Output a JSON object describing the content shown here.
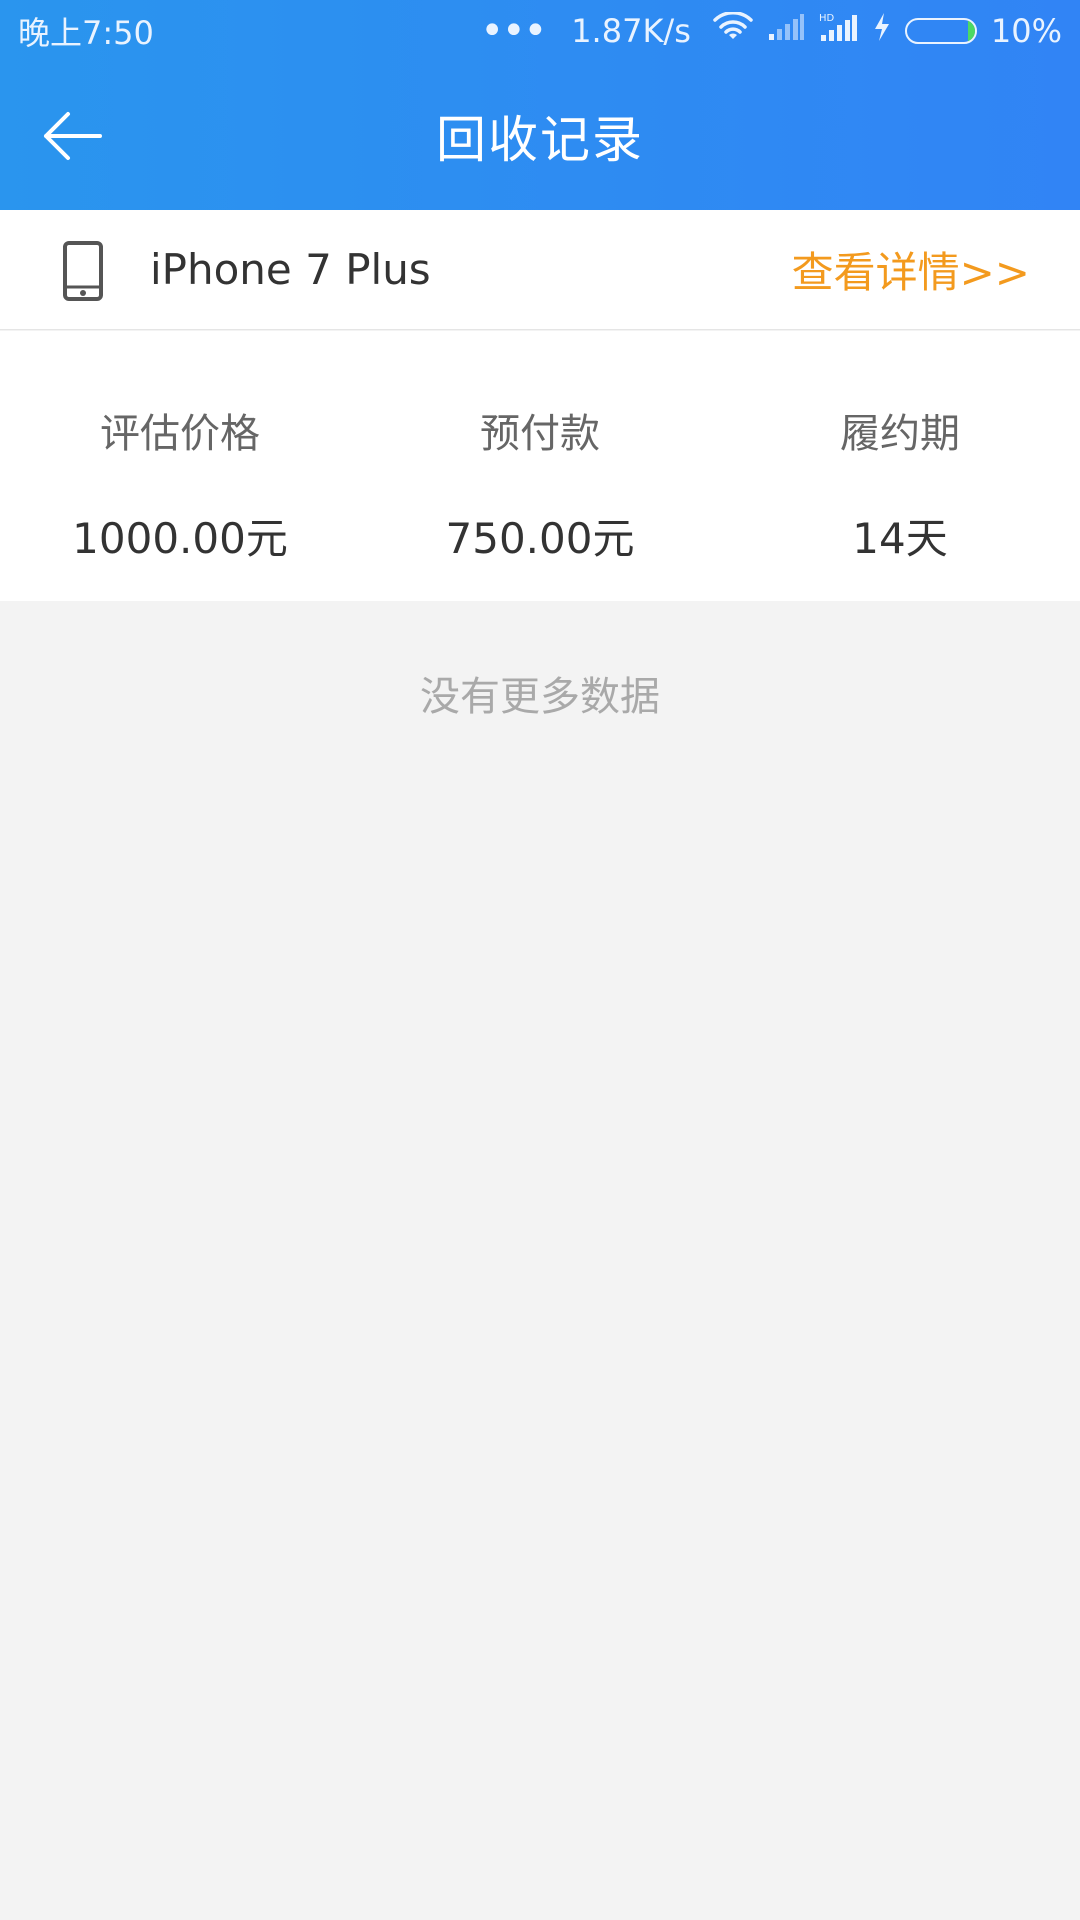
{
  "status_bar": {
    "time": "晚上7:50",
    "more_indicator": "•••",
    "net_speed": "1.87K/s",
    "battery_percent": "10%",
    "battery_level": 0.1,
    "icons": [
      "wifi-icon",
      "signal-icon",
      "hd-signal-icon",
      "charging-icon",
      "battery-icon"
    ]
  },
  "header": {
    "title": "回收记录",
    "back_icon": "arrow-left-icon"
  },
  "record": {
    "device_icon": "phone-icon",
    "device_name": "iPhone 7 Plus",
    "detail_link": "查看详情>>",
    "stats": [
      {
        "label": "评估价格",
        "value": "1000.00元"
      },
      {
        "label": "预付款",
        "value": "750.00元"
      },
      {
        "label": "履约期",
        "value": "14天"
      }
    ]
  },
  "footer": {
    "no_more": "没有更多数据"
  },
  "colors": {
    "header_start": "#2a95ee",
    "header_end": "#3184f5",
    "link": "#f39a1e",
    "background": "#f3f3f3"
  }
}
